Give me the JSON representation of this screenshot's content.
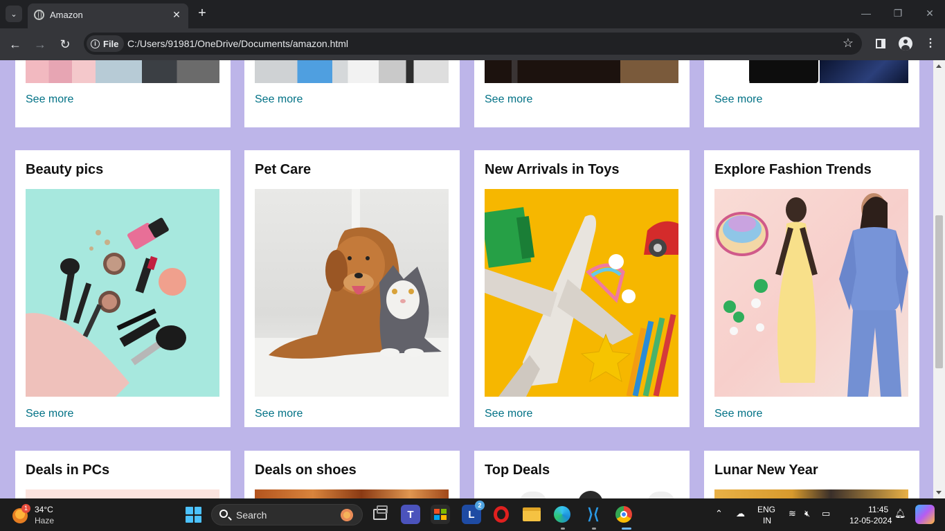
{
  "browser": {
    "tab_title": "Amazon",
    "new_tab_symbol": "+",
    "close_symbol": "✕",
    "chip_label": "File",
    "url": "C:/Users/91981/OneDrive/Documents/amazon.html"
  },
  "cards_row1": [
    {
      "see_more": "See more"
    },
    {
      "see_more": "See more"
    },
    {
      "see_more": "See more"
    },
    {
      "see_more": "See more"
    }
  ],
  "cards_row2": [
    {
      "title": "Beauty pics",
      "see_more": "See more",
      "image": "cosmetics-image"
    },
    {
      "title": "Pet Care",
      "see_more": "See more",
      "image": "dog-and-cat-image"
    },
    {
      "title": "New Arrivals in Toys",
      "see_more": "See more",
      "image": "toy-airplane-image"
    },
    {
      "title": "Explore Fashion Trends",
      "see_more": "See more",
      "image": "fashion-models-image"
    }
  ],
  "cards_row3": [
    {
      "title": "Deals in PCs"
    },
    {
      "title": "Deals on shoes"
    },
    {
      "title": "Top Deals"
    },
    {
      "title": "Lunar New Year"
    }
  ],
  "taskbar": {
    "weather_badge": "1",
    "temperature": "34°C",
    "condition": "Haze",
    "search_label": "Search",
    "lens_badge": "2",
    "language": "ENG",
    "region": "IN",
    "time": "11:45",
    "date": "12-05-2024"
  },
  "colors": {
    "page_background": "#bdb5e9",
    "link": "#007185",
    "card": "#ffffff"
  }
}
